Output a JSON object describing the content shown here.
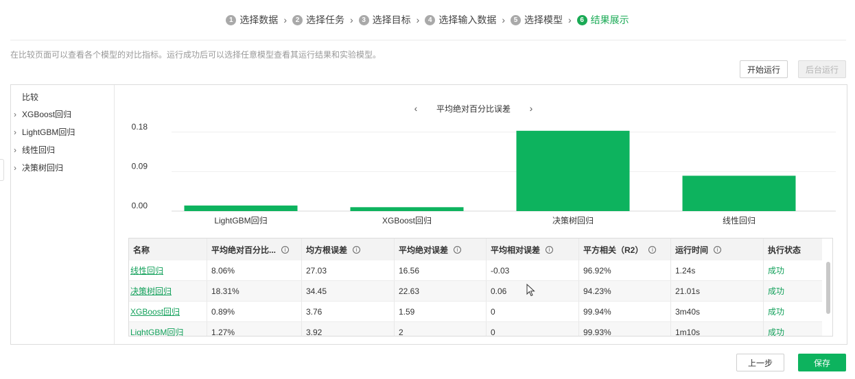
{
  "steps": [
    {
      "num": "1",
      "label": "选择数据"
    },
    {
      "num": "2",
      "label": "选择任务"
    },
    {
      "num": "3",
      "label": "选择目标"
    },
    {
      "num": "4",
      "label": "选择输入数据"
    },
    {
      "num": "5",
      "label": "选择模型"
    },
    {
      "num": "6",
      "label": "结果展示"
    }
  ],
  "description": "在比较页面可以查看各个模型的对比指标。运行成功后可以选择任意模型查看其运行结果和实验模型。",
  "buttons": {
    "start": "开始运行",
    "background": "后台运行",
    "prev": "上一步",
    "save": "保存"
  },
  "sidebar": {
    "title": "比较",
    "items": [
      "XGBoost回归",
      "LightGBM回归",
      "线性回归",
      "决策树回归"
    ]
  },
  "chart_data": {
    "type": "bar",
    "title": "平均绝对百分比误差",
    "categories": [
      "LightGBM回归",
      "XGBoost回归",
      "决策树回归",
      "线性回归"
    ],
    "values": [
      0.0127,
      0.0089,
      0.1831,
      0.0806
    ],
    "yticks": [
      "0.00",
      "0.09",
      "0.18"
    ],
    "ylim": [
      0,
      0.2
    ],
    "color": "#0db35e",
    "grid": true
  },
  "table": {
    "headers": [
      "名称",
      "平均绝对百分比...",
      "均方根误差",
      "平均绝对误差",
      "平均相对误差",
      "平方相关（R2）",
      "运行时间",
      "执行状态"
    ],
    "rows": [
      [
        "线性回归",
        "8.06%",
        "27.03",
        "16.56",
        "-0.03",
        "96.92%",
        "1.24s",
        "成功"
      ],
      [
        "决策树回归",
        "18.31%",
        "34.45",
        "22.63",
        "0.06",
        "94.23%",
        "21.01s",
        "成功"
      ],
      [
        "XGBoost回归",
        "0.89%",
        "3.76",
        "1.59",
        "0",
        "99.94%",
        "3m40s",
        "成功"
      ],
      [
        "LightGBM回归",
        "1.27%",
        "3.92",
        "2",
        "0",
        "99.93%",
        "1m10s",
        "成功"
      ]
    ]
  },
  "colors": {
    "accent": "#0db35e",
    "link": "#12a05a"
  }
}
